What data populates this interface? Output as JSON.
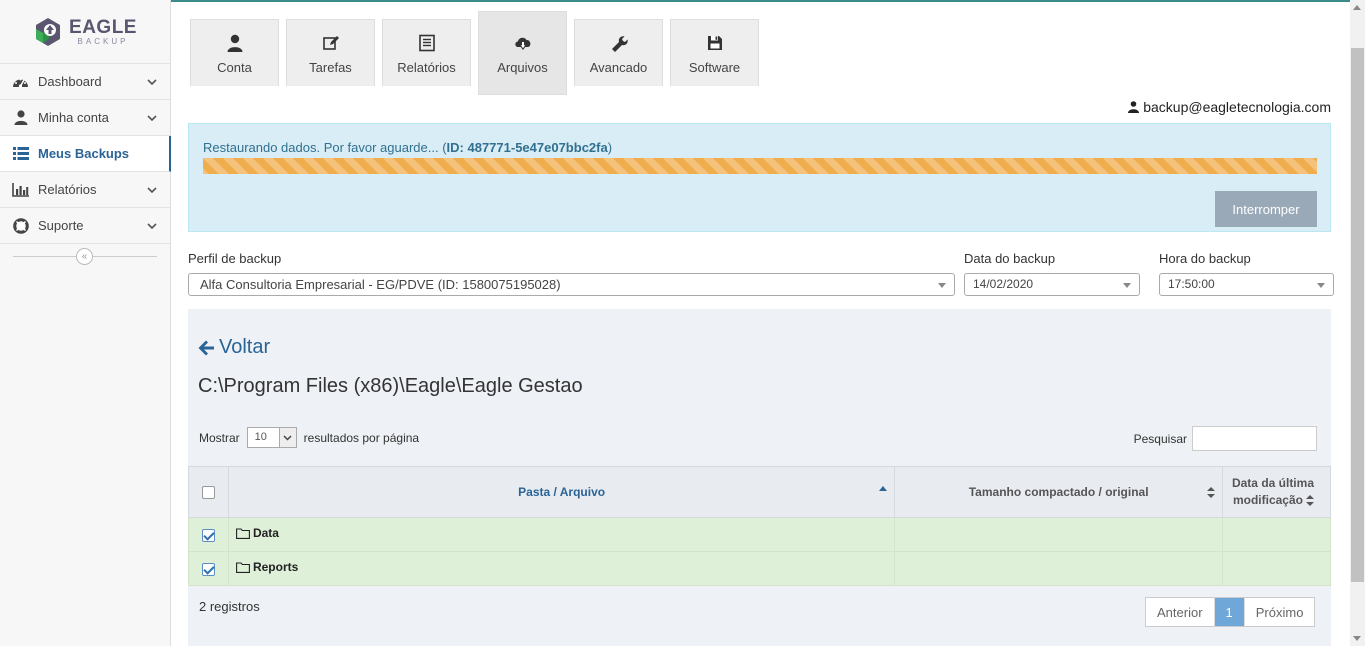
{
  "brand": {
    "name": "EAGLE",
    "sub": "BACKUP"
  },
  "sidebar": {
    "items": [
      {
        "label": "Dashboard",
        "icon": "dashboard-icon",
        "has_chevron": true
      },
      {
        "label": "Minha conta",
        "icon": "user-icon",
        "has_chevron": true
      },
      {
        "label": "Meus Backups",
        "icon": "list-icon",
        "has_chevron": false,
        "active": true
      },
      {
        "label": "Relatórios",
        "icon": "bar-chart-icon",
        "has_chevron": true
      },
      {
        "label": "Suporte",
        "icon": "lifebuoy-icon",
        "has_chevron": true
      }
    ]
  },
  "tabs": [
    {
      "label": "Conta",
      "icon": "user-icon"
    },
    {
      "label": "Tarefas",
      "icon": "edit-icon"
    },
    {
      "label": "Relatórios",
      "icon": "report-icon"
    },
    {
      "label": "Arquivos",
      "icon": "cloud-download-icon",
      "active": true
    },
    {
      "label": "Avancado",
      "icon": "wrench-icon"
    },
    {
      "label": "Software",
      "icon": "save-icon"
    }
  ],
  "user": {
    "email": "backup@eagletecnologia.com"
  },
  "alert": {
    "message": "Restaurando dados. Por favor aguarde... (",
    "id": "ID: 487771-5e47e07bbc2fa",
    "close_paren": ")",
    "progress": 1.0,
    "stop_label": "Interromper",
    "colors": {
      "bg": "#d9edf7",
      "bar": "#f0ad4e"
    }
  },
  "filters": {
    "profile_label": "Perfil de backup",
    "profile_value": "Alfa Consultoria Empresarial - EG/PDVE (ID: 1580075195028)",
    "date_label": "Data do backup",
    "date_value": "14/02/2020",
    "time_label": "Hora do backup",
    "time_value": "17:50:00"
  },
  "browser": {
    "back_label": "Voltar",
    "path": "C:\\Program Files (x86)\\Eagle\\Eagle Gestao",
    "show_label": "Mostrar",
    "page_size": "10",
    "per_page_label": "resultados por página",
    "search_label": "Pesquisar",
    "search_value": "",
    "columns": {
      "name": "Pasta / Arquivo",
      "size": "Tamanho compactado / original",
      "modified_1": "Data da última",
      "modified_2": "modificação"
    },
    "rows": [
      {
        "name": "Data",
        "size": "",
        "modified": "",
        "checked": true
      },
      {
        "name": "Reports",
        "size": "",
        "modified": "",
        "checked": true
      }
    ],
    "records": "2 registros",
    "pager": {
      "prev": "Anterior",
      "current": "1",
      "next": "Próximo"
    }
  }
}
